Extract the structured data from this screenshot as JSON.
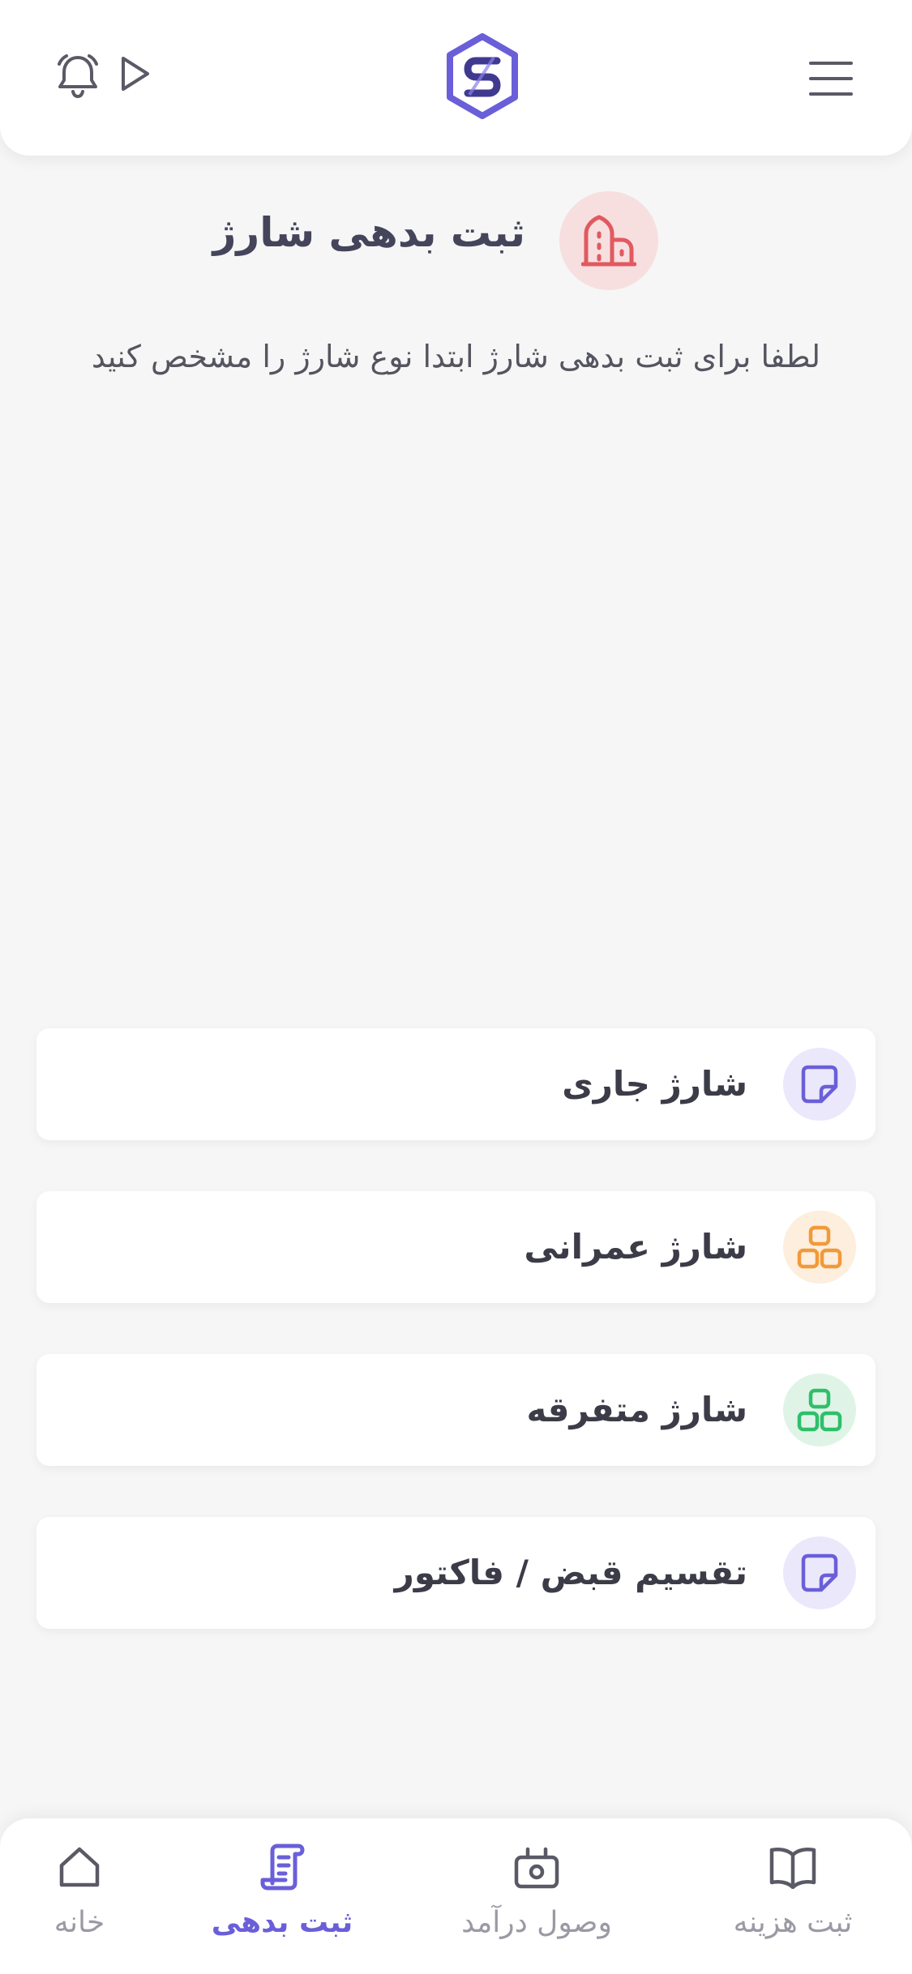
{
  "header": {
    "menu_icon": "hamburger-menu-icon",
    "logo_icon": "s-hexagon-logo",
    "play_icon": "play-icon",
    "bell_icon": "notification-bell-icon"
  },
  "page": {
    "title": "ثبت بدهی شارژ",
    "title_icon": "building-icon",
    "subtitle": "لطفا برای ثبت بدهی شارژ ابتدا نوع شارژ را مشخص کنید"
  },
  "options": [
    {
      "label": "شارژ جاری",
      "icon": "note-icon",
      "color": "#6a5fd8",
      "bg": "#ebe8fb"
    },
    {
      "label": "شارژ عمرانی",
      "icon": "blocks-icon",
      "color": "#f2993a",
      "bg": "#fdeedd"
    },
    {
      "label": "شارژ متفرقه",
      "icon": "blocks-icon",
      "color": "#2fbf6a",
      "bg": "#dff4e7"
    },
    {
      "label": "تقسیم قبض / فاکتور",
      "icon": "note-icon",
      "color": "#6a5fd8",
      "bg": "#ebe8fb"
    }
  ],
  "bottom_nav": {
    "home": {
      "label": "خانه",
      "icon": "home-icon"
    },
    "debt": {
      "label": "ثبت بدهی",
      "icon": "scroll-icon",
      "active": true
    },
    "income": {
      "label": "وصول درآمد",
      "icon": "cash-register-icon"
    },
    "expense": {
      "label": "ثبت هزینه",
      "icon": "book-icon"
    }
  },
  "colors": {
    "accent": "#6a5fd8",
    "danger": "#e05a5f",
    "background": "#f6f6f7"
  }
}
